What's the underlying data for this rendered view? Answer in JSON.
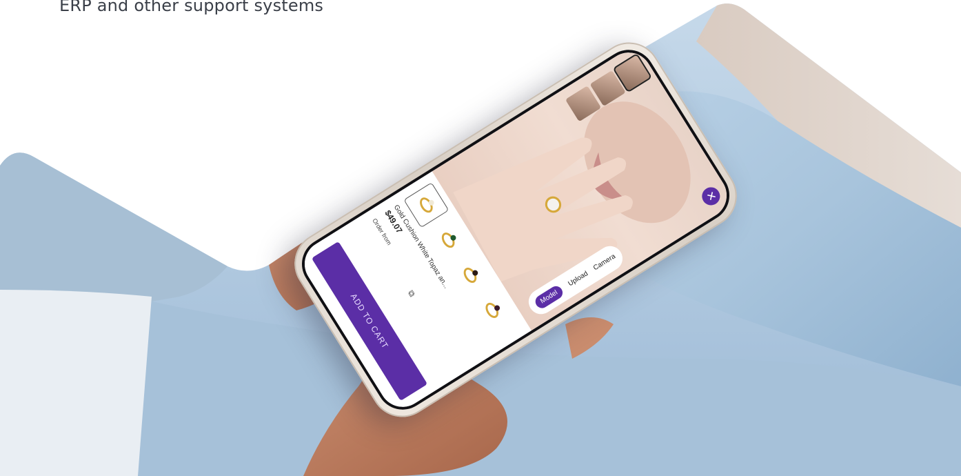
{
  "caption": "ERP and other support systems",
  "tryon": {
    "close_icon": "close-icon",
    "modes": [
      {
        "label": "Camera",
        "active": false
      },
      {
        "label": "Upload",
        "active": false
      },
      {
        "label": "Model",
        "active": true
      }
    ]
  },
  "product": {
    "title": "Gold Cushion White Topaz an...",
    "price": "$49.07",
    "link": "Order from ",
    "cart_label": "ADD TO CART",
    "ring_gems": [
      "#f0e9d6",
      "#1f5a2e",
      "#2a1a14",
      "#3a1a2a"
    ]
  },
  "colors": {
    "accent": "#5b2ea6",
    "gold": "#d6a83a"
  }
}
